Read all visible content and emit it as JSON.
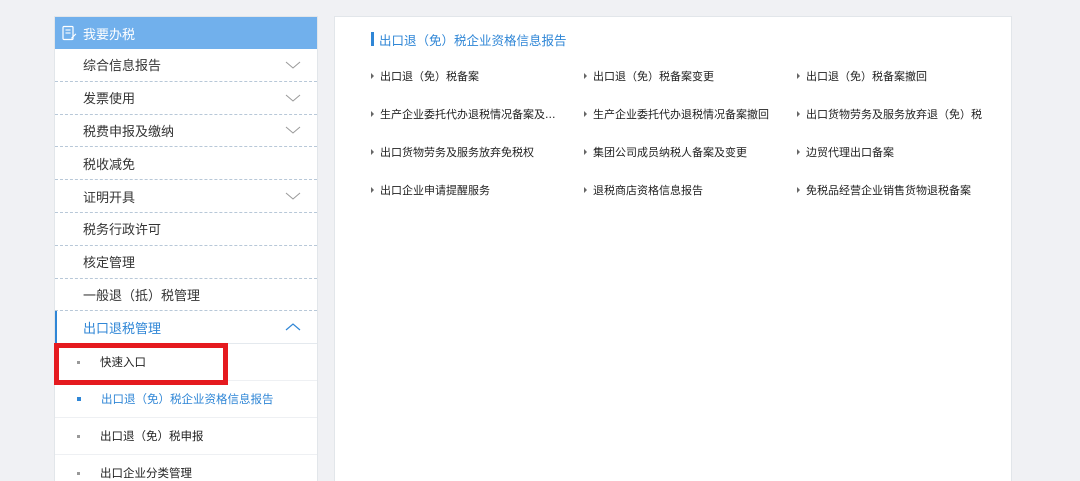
{
  "sidebar": {
    "header": "我要办税",
    "items": [
      {
        "label": "综合信息报告",
        "expandable": true
      },
      {
        "label": "发票使用",
        "expandable": true
      },
      {
        "label": "税费申报及缴纳",
        "expandable": true
      },
      {
        "label": "税收减免",
        "expandable": false
      },
      {
        "label": "证明开具",
        "expandable": true
      },
      {
        "label": "税务行政许可",
        "expandable": false
      },
      {
        "label": "核定管理",
        "expandable": false
      },
      {
        "label": "一般退（抵）税管理",
        "expandable": false
      },
      {
        "label": "出口退税管理",
        "expandable": true,
        "expanded": true
      }
    ],
    "sub_items": [
      {
        "label": "快速入口"
      },
      {
        "label": "出口退（免）税企业资格信息报告",
        "selected": true
      },
      {
        "label": "出口退（免）税申报"
      },
      {
        "label": "出口企业分类管理"
      }
    ]
  },
  "main": {
    "title": "出口退（免）税企业资格信息报告",
    "links": [
      "出口退（免）税备案",
      "出口退（免）税备案变更",
      "出口退（免）税备案撤回",
      "生产企业委托代办退税情况备案及...",
      "生产企业委托代办退税情况备案撤回",
      "出口货物劳务及服务放弃退（免）税",
      "出口货物劳务及服务放弃免税权",
      "集团公司成员纳税人备案及变更",
      "边贸代理出口备案",
      "出口企业申请提醒服务",
      "退税商店资格信息报告",
      "免税品经营企业销售货物退税备案"
    ]
  },
  "colors": {
    "accent": "#2f86d6",
    "header_bg": "#71b0ec",
    "highlight": "#e51a1f"
  }
}
